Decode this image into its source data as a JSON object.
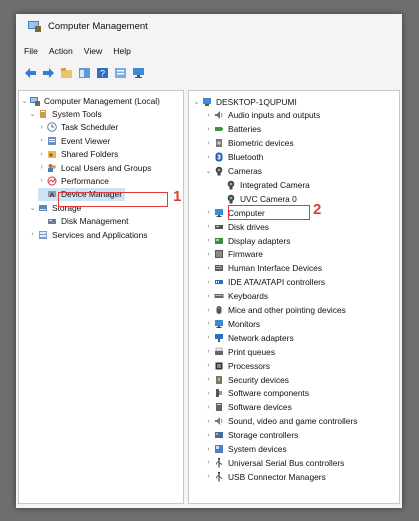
{
  "window": {
    "title": "Computer Management"
  },
  "menu": [
    "File",
    "Action",
    "View",
    "Help"
  ],
  "toolbar_icons": [
    "back-arrow-icon",
    "forward-arrow-icon",
    "up-folder-icon",
    "show-hide-tree-icon",
    "help-icon",
    "properties-icon",
    "monitor-icon"
  ],
  "left_tree": [
    {
      "label": "Computer Management (Local)",
      "icon": "computer-management-icon",
      "expander": "open"
    },
    {
      "label": "System Tools",
      "icon": "tools-icon",
      "expander": "open"
    },
    {
      "label": "Task Scheduler",
      "icon": "clock-icon",
      "expander": "closed"
    },
    {
      "label": "Event Viewer",
      "icon": "event-viewer-icon",
      "expander": "closed"
    },
    {
      "label": "Shared Folders",
      "icon": "shared-folder-icon",
      "expander": "closed"
    },
    {
      "label": "Local Users and Groups",
      "icon": "users-icon",
      "expander": "closed"
    },
    {
      "label": "Performance",
      "icon": "performance-icon",
      "expander": "closed"
    },
    {
      "label": "Device Manager",
      "icon": "device-manager-icon",
      "expander": "",
      "selected": true
    },
    {
      "label": "Storage",
      "icon": "storage-icon",
      "expander": "open"
    },
    {
      "label": "Disk Management",
      "icon": "disk-icon",
      "expander": ""
    },
    {
      "label": "Services and Applications",
      "icon": "services-icon",
      "expander": "closed"
    }
  ],
  "right_tree": [
    {
      "label": "DESKTOP-1QUPUMI",
      "icon": "computer-icon",
      "expander": "open"
    },
    {
      "label": "Audio inputs and outputs",
      "icon": "speaker-icon",
      "expander": "closed"
    },
    {
      "label": "Batteries",
      "icon": "battery-icon",
      "expander": "closed"
    },
    {
      "label": "Biometric devices",
      "icon": "biometric-icon",
      "expander": "closed"
    },
    {
      "label": "Bluetooth",
      "icon": "bluetooth-icon",
      "expander": "closed"
    },
    {
      "label": "Cameras",
      "icon": "camera-icon",
      "expander": "open"
    },
    {
      "label": "Integrated Camera",
      "icon": "camera-icon",
      "expander": ""
    },
    {
      "label": "UVC Camera 0",
      "icon": "camera-icon",
      "expander": ""
    },
    {
      "label": "Computer",
      "icon": "monitor-icon",
      "expander": "closed"
    },
    {
      "label": "Disk drives",
      "icon": "disk-drive-icon",
      "expander": "closed"
    },
    {
      "label": "Display adapters",
      "icon": "display-adapter-icon",
      "expander": "closed"
    },
    {
      "label": "Firmware",
      "icon": "firmware-icon",
      "expander": "closed"
    },
    {
      "label": "Human Interface Devices",
      "icon": "hid-icon",
      "expander": "closed"
    },
    {
      "label": "IDE ATA/ATAPI controllers",
      "icon": "ide-icon",
      "expander": "closed"
    },
    {
      "label": "Keyboards",
      "icon": "keyboard-icon",
      "expander": "closed"
    },
    {
      "label": "Mice and other pointing devices",
      "icon": "mouse-icon",
      "expander": "closed"
    },
    {
      "label": "Monitors",
      "icon": "monitor-icon",
      "expander": "closed"
    },
    {
      "label": "Network adapters",
      "icon": "network-icon",
      "expander": "closed"
    },
    {
      "label": "Print queues",
      "icon": "printer-icon",
      "expander": "closed"
    },
    {
      "label": "Processors",
      "icon": "processor-icon",
      "expander": "closed"
    },
    {
      "label": "Security devices",
      "icon": "security-icon",
      "expander": "closed"
    },
    {
      "label": "Software components",
      "icon": "software-component-icon",
      "expander": "closed"
    },
    {
      "label": "Software devices",
      "icon": "software-device-icon",
      "expander": "closed"
    },
    {
      "label": "Sound, video and game controllers",
      "icon": "sound-icon",
      "expander": "closed"
    },
    {
      "label": "Storage controllers",
      "icon": "storage-controller-icon",
      "expander": "closed"
    },
    {
      "label": "System devices",
      "icon": "system-device-icon",
      "expander": "closed"
    },
    {
      "label": "Universal Serial Bus controllers",
      "icon": "usb-icon",
      "expander": "closed"
    },
    {
      "label": "USB Connector Managers",
      "icon": "usb-icon",
      "expander": "closed"
    }
  ],
  "callouts": [
    "1",
    "2"
  ],
  "colors": {
    "highlight": "#e53935",
    "selection": "#cfe3f7"
  }
}
